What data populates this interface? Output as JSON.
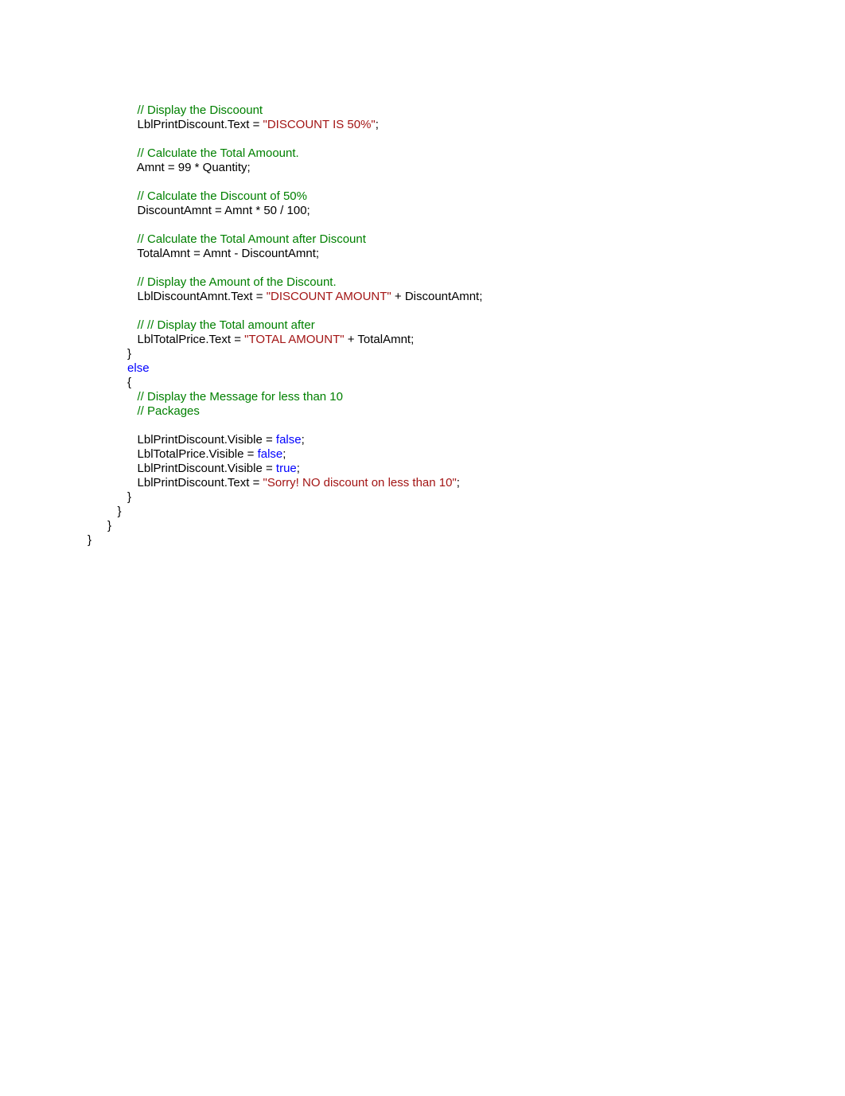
{
  "code": {
    "lines": [
      {
        "indent": 5,
        "segments": [
          {
            "cls": "comment",
            "text": "// Display the Discoount"
          }
        ]
      },
      {
        "indent": 5,
        "segments": [
          {
            "cls": "plain",
            "text": "LblPrintDiscount.Text = "
          },
          {
            "cls": "string",
            "text": "\"DISCOUNT IS 50%\""
          },
          {
            "cls": "plain",
            "text": ";"
          }
        ]
      },
      {
        "indent": 0,
        "segments": [
          {
            "cls": "plain",
            "text": ""
          }
        ]
      },
      {
        "indent": 5,
        "segments": [
          {
            "cls": "comment",
            "text": "// Calculate the Total Amoount."
          }
        ]
      },
      {
        "indent": 5,
        "segments": [
          {
            "cls": "plain",
            "text": "Amnt = 99 * Quantity;"
          }
        ]
      },
      {
        "indent": 0,
        "segments": [
          {
            "cls": "plain",
            "text": ""
          }
        ]
      },
      {
        "indent": 5,
        "segments": [
          {
            "cls": "comment",
            "text": "// Calculate the Discount of 50%"
          }
        ]
      },
      {
        "indent": 5,
        "segments": [
          {
            "cls": "plain",
            "text": "DiscountAmnt = Amnt * 50 / 100;"
          }
        ]
      },
      {
        "indent": 0,
        "segments": [
          {
            "cls": "plain",
            "text": ""
          }
        ]
      },
      {
        "indent": 5,
        "segments": [
          {
            "cls": "comment",
            "text": "// Calculate the Total Amount after Discount"
          }
        ]
      },
      {
        "indent": 5,
        "segments": [
          {
            "cls": "plain",
            "text": "TotalAmnt = Amnt - DiscountAmnt;"
          }
        ]
      },
      {
        "indent": 0,
        "segments": [
          {
            "cls": "plain",
            "text": ""
          }
        ]
      },
      {
        "indent": 5,
        "segments": [
          {
            "cls": "comment",
            "text": "// Display the Amount of the Discount."
          }
        ]
      },
      {
        "indent": 5,
        "segments": [
          {
            "cls": "plain",
            "text": "LblDiscountAmnt.Text = "
          },
          {
            "cls": "string",
            "text": "\"DISCOUNT AMOUNT\""
          },
          {
            "cls": "plain",
            "text": " + DiscountAmnt;"
          }
        ]
      },
      {
        "indent": 0,
        "segments": [
          {
            "cls": "plain",
            "text": ""
          }
        ]
      },
      {
        "indent": 5,
        "segments": [
          {
            "cls": "comment",
            "text": "// // Display the Total amount after"
          }
        ]
      },
      {
        "indent": 5,
        "segments": [
          {
            "cls": "plain",
            "text": "LblTotalPrice.Text = "
          },
          {
            "cls": "string",
            "text": "\"TOTAL AMOUNT\""
          },
          {
            "cls": "plain",
            "text": " + TotalAmnt;"
          }
        ]
      },
      {
        "indent": 4,
        "segments": [
          {
            "cls": "plain",
            "text": "}"
          }
        ]
      },
      {
        "indent": 4,
        "segments": [
          {
            "cls": "keyword",
            "text": "else"
          }
        ]
      },
      {
        "indent": 4,
        "segments": [
          {
            "cls": "plain",
            "text": "{"
          }
        ]
      },
      {
        "indent": 5,
        "segments": [
          {
            "cls": "comment",
            "text": "// Display the Message for less than 10"
          }
        ]
      },
      {
        "indent": 5,
        "segments": [
          {
            "cls": "comment",
            "text": "// Packages"
          }
        ]
      },
      {
        "indent": 0,
        "segments": [
          {
            "cls": "plain",
            "text": ""
          }
        ]
      },
      {
        "indent": 5,
        "segments": [
          {
            "cls": "plain",
            "text": "LblPrintDiscount.Visible = "
          },
          {
            "cls": "keyword",
            "text": "false"
          },
          {
            "cls": "plain",
            "text": ";"
          }
        ]
      },
      {
        "indent": 5,
        "segments": [
          {
            "cls": "plain",
            "text": "LblTotalPrice.Visible = "
          },
          {
            "cls": "keyword",
            "text": "false"
          },
          {
            "cls": "plain",
            "text": ";"
          }
        ]
      },
      {
        "indent": 5,
        "segments": [
          {
            "cls": "plain",
            "text": "LblPrintDiscount.Visible = "
          },
          {
            "cls": "keyword",
            "text": "true"
          },
          {
            "cls": "plain",
            "text": ";"
          }
        ]
      },
      {
        "indent": 5,
        "segments": [
          {
            "cls": "plain",
            "text": "LblPrintDiscount.Text = "
          },
          {
            "cls": "string",
            "text": "\"Sorry! NO discount on less than 10\""
          },
          {
            "cls": "plain",
            "text": ";"
          }
        ]
      },
      {
        "indent": 4,
        "segments": [
          {
            "cls": "plain",
            "text": "}"
          }
        ]
      },
      {
        "indent": 3,
        "segments": [
          {
            "cls": "plain",
            "text": "}"
          }
        ]
      },
      {
        "indent": 2,
        "segments": [
          {
            "cls": "plain",
            "text": "}"
          }
        ]
      },
      {
        "indent": 0,
        "segments": [
          {
            "cls": "plain",
            "text": "}"
          }
        ]
      }
    ]
  },
  "indent_unit": "   "
}
